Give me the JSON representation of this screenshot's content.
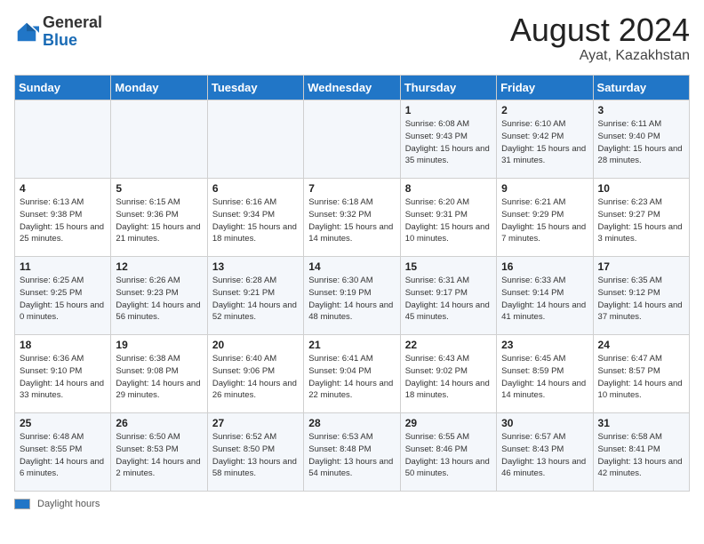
{
  "logo": {
    "general": "General",
    "blue": "Blue"
  },
  "title": "August 2024",
  "location": "Ayat, Kazakhstan",
  "days_of_week": [
    "Sunday",
    "Monday",
    "Tuesday",
    "Wednesday",
    "Thursday",
    "Friday",
    "Saturday"
  ],
  "footer_label": "Daylight hours",
  "weeks": [
    [
      {
        "day": "",
        "info": ""
      },
      {
        "day": "",
        "info": ""
      },
      {
        "day": "",
        "info": ""
      },
      {
        "day": "",
        "info": ""
      },
      {
        "day": "1",
        "info": "Sunrise: 6:08 AM\nSunset: 9:43 PM\nDaylight: 15 hours and 35 minutes."
      },
      {
        "day": "2",
        "info": "Sunrise: 6:10 AM\nSunset: 9:42 PM\nDaylight: 15 hours and 31 minutes."
      },
      {
        "day": "3",
        "info": "Sunrise: 6:11 AM\nSunset: 9:40 PM\nDaylight: 15 hours and 28 minutes."
      }
    ],
    [
      {
        "day": "4",
        "info": "Sunrise: 6:13 AM\nSunset: 9:38 PM\nDaylight: 15 hours and 25 minutes."
      },
      {
        "day": "5",
        "info": "Sunrise: 6:15 AM\nSunset: 9:36 PM\nDaylight: 15 hours and 21 minutes."
      },
      {
        "day": "6",
        "info": "Sunrise: 6:16 AM\nSunset: 9:34 PM\nDaylight: 15 hours and 18 minutes."
      },
      {
        "day": "7",
        "info": "Sunrise: 6:18 AM\nSunset: 9:32 PM\nDaylight: 15 hours and 14 minutes."
      },
      {
        "day": "8",
        "info": "Sunrise: 6:20 AM\nSunset: 9:31 PM\nDaylight: 15 hours and 10 minutes."
      },
      {
        "day": "9",
        "info": "Sunrise: 6:21 AM\nSunset: 9:29 PM\nDaylight: 15 hours and 7 minutes."
      },
      {
        "day": "10",
        "info": "Sunrise: 6:23 AM\nSunset: 9:27 PM\nDaylight: 15 hours and 3 minutes."
      }
    ],
    [
      {
        "day": "11",
        "info": "Sunrise: 6:25 AM\nSunset: 9:25 PM\nDaylight: 15 hours and 0 minutes."
      },
      {
        "day": "12",
        "info": "Sunrise: 6:26 AM\nSunset: 9:23 PM\nDaylight: 14 hours and 56 minutes."
      },
      {
        "day": "13",
        "info": "Sunrise: 6:28 AM\nSunset: 9:21 PM\nDaylight: 14 hours and 52 minutes."
      },
      {
        "day": "14",
        "info": "Sunrise: 6:30 AM\nSunset: 9:19 PM\nDaylight: 14 hours and 48 minutes."
      },
      {
        "day": "15",
        "info": "Sunrise: 6:31 AM\nSunset: 9:17 PM\nDaylight: 14 hours and 45 minutes."
      },
      {
        "day": "16",
        "info": "Sunrise: 6:33 AM\nSunset: 9:14 PM\nDaylight: 14 hours and 41 minutes."
      },
      {
        "day": "17",
        "info": "Sunrise: 6:35 AM\nSunset: 9:12 PM\nDaylight: 14 hours and 37 minutes."
      }
    ],
    [
      {
        "day": "18",
        "info": "Sunrise: 6:36 AM\nSunset: 9:10 PM\nDaylight: 14 hours and 33 minutes."
      },
      {
        "day": "19",
        "info": "Sunrise: 6:38 AM\nSunset: 9:08 PM\nDaylight: 14 hours and 29 minutes."
      },
      {
        "day": "20",
        "info": "Sunrise: 6:40 AM\nSunset: 9:06 PM\nDaylight: 14 hours and 26 minutes."
      },
      {
        "day": "21",
        "info": "Sunrise: 6:41 AM\nSunset: 9:04 PM\nDaylight: 14 hours and 22 minutes."
      },
      {
        "day": "22",
        "info": "Sunrise: 6:43 AM\nSunset: 9:02 PM\nDaylight: 14 hours and 18 minutes."
      },
      {
        "day": "23",
        "info": "Sunrise: 6:45 AM\nSunset: 8:59 PM\nDaylight: 14 hours and 14 minutes."
      },
      {
        "day": "24",
        "info": "Sunrise: 6:47 AM\nSunset: 8:57 PM\nDaylight: 14 hours and 10 minutes."
      }
    ],
    [
      {
        "day": "25",
        "info": "Sunrise: 6:48 AM\nSunset: 8:55 PM\nDaylight: 14 hours and 6 minutes."
      },
      {
        "day": "26",
        "info": "Sunrise: 6:50 AM\nSunset: 8:53 PM\nDaylight: 14 hours and 2 minutes."
      },
      {
        "day": "27",
        "info": "Sunrise: 6:52 AM\nSunset: 8:50 PM\nDaylight: 13 hours and 58 minutes."
      },
      {
        "day": "28",
        "info": "Sunrise: 6:53 AM\nSunset: 8:48 PM\nDaylight: 13 hours and 54 minutes."
      },
      {
        "day": "29",
        "info": "Sunrise: 6:55 AM\nSunset: 8:46 PM\nDaylight: 13 hours and 50 minutes."
      },
      {
        "day": "30",
        "info": "Sunrise: 6:57 AM\nSunset: 8:43 PM\nDaylight: 13 hours and 46 minutes."
      },
      {
        "day": "31",
        "info": "Sunrise: 6:58 AM\nSunset: 8:41 PM\nDaylight: 13 hours and 42 minutes."
      }
    ]
  ]
}
